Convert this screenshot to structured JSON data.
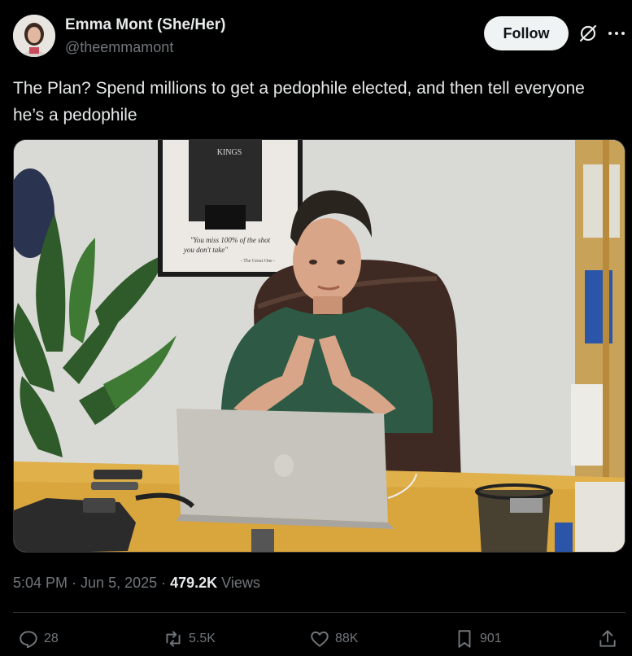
{
  "author": {
    "name": "Emma Mont (She/Her)",
    "handle": "@theemmamont",
    "avatar_icon": "profile-photo"
  },
  "follow_button": {
    "label": "Follow"
  },
  "post": {
    "text": "The Plan? Spend millions to get a pedophile elected, and then tell everyone he’s a pedophile"
  },
  "media": {
    "poster_quote_line1": "\"You miss 100% of the shot",
    "poster_quote_line2": "you don't take\"",
    "poster_attrib": "- The Great One -",
    "jersey_text": "KINGS"
  },
  "meta": {
    "time": "5:04 PM",
    "sep1": " · ",
    "date": "Jun 5, 2025",
    "sep2": " · ",
    "views_count": "479.2K",
    "views_label": " Views"
  },
  "actions": {
    "replies": "28",
    "reposts": "5.5K",
    "likes": "88K",
    "bookmarks": "901"
  },
  "colors": {
    "background": "#000000",
    "text": "#e7e9ea",
    "muted": "#71767b",
    "follow_bg": "#eff3f4"
  }
}
